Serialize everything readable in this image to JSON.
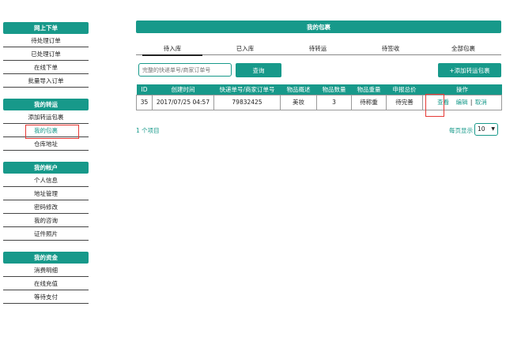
{
  "sidebar": {
    "sections": [
      {
        "title": "网上下单",
        "items": [
          "待处理订单",
          "已处理订单",
          "在线下单",
          "批量导入订单"
        ]
      },
      {
        "title": "我的转运",
        "items": [
          "添加转运包裹",
          "我的包裹",
          "仓库地址"
        ]
      },
      {
        "title": "我的帐户",
        "items": [
          "个人信息",
          "地址管理",
          "密码修改",
          "我的咨询",
          "证件照片"
        ]
      },
      {
        "title": "我的资金",
        "items": [
          "消费明细",
          "在线充值",
          "等待支付"
        ]
      }
    ]
  },
  "main": {
    "title": "我的包裹",
    "tabs": [
      "待入库",
      "已入库",
      "待转运",
      "待签收",
      "全部包裹"
    ],
    "search_placeholder": "完整的快递单号/商家订单号",
    "search_button": "查询",
    "add_button": "+添加转运包裹",
    "table": {
      "headers": [
        "ID",
        "创建时间",
        "快递单号/商家订单号",
        "物品概述",
        "物品数量",
        "物品重量",
        "申报总价",
        "操作"
      ],
      "rows": [
        {
          "id": "35",
          "created": "2017/07/25 04:57",
          "tracking": "79832425",
          "summary": "美妆",
          "qty": "3",
          "weight": "待称重",
          "declared": "待完善",
          "ops": {
            "view": "查看",
            "edit": "编辑",
            "cancel": "取消",
            "sep": "|"
          }
        }
      ]
    },
    "item_count": "1 个项目",
    "per_page_label": "每页显示",
    "per_page_value": "10",
    "per_page_arrow": "▼"
  },
  "colors": {
    "accent": "#17998a",
    "highlight": "#e53935"
  }
}
